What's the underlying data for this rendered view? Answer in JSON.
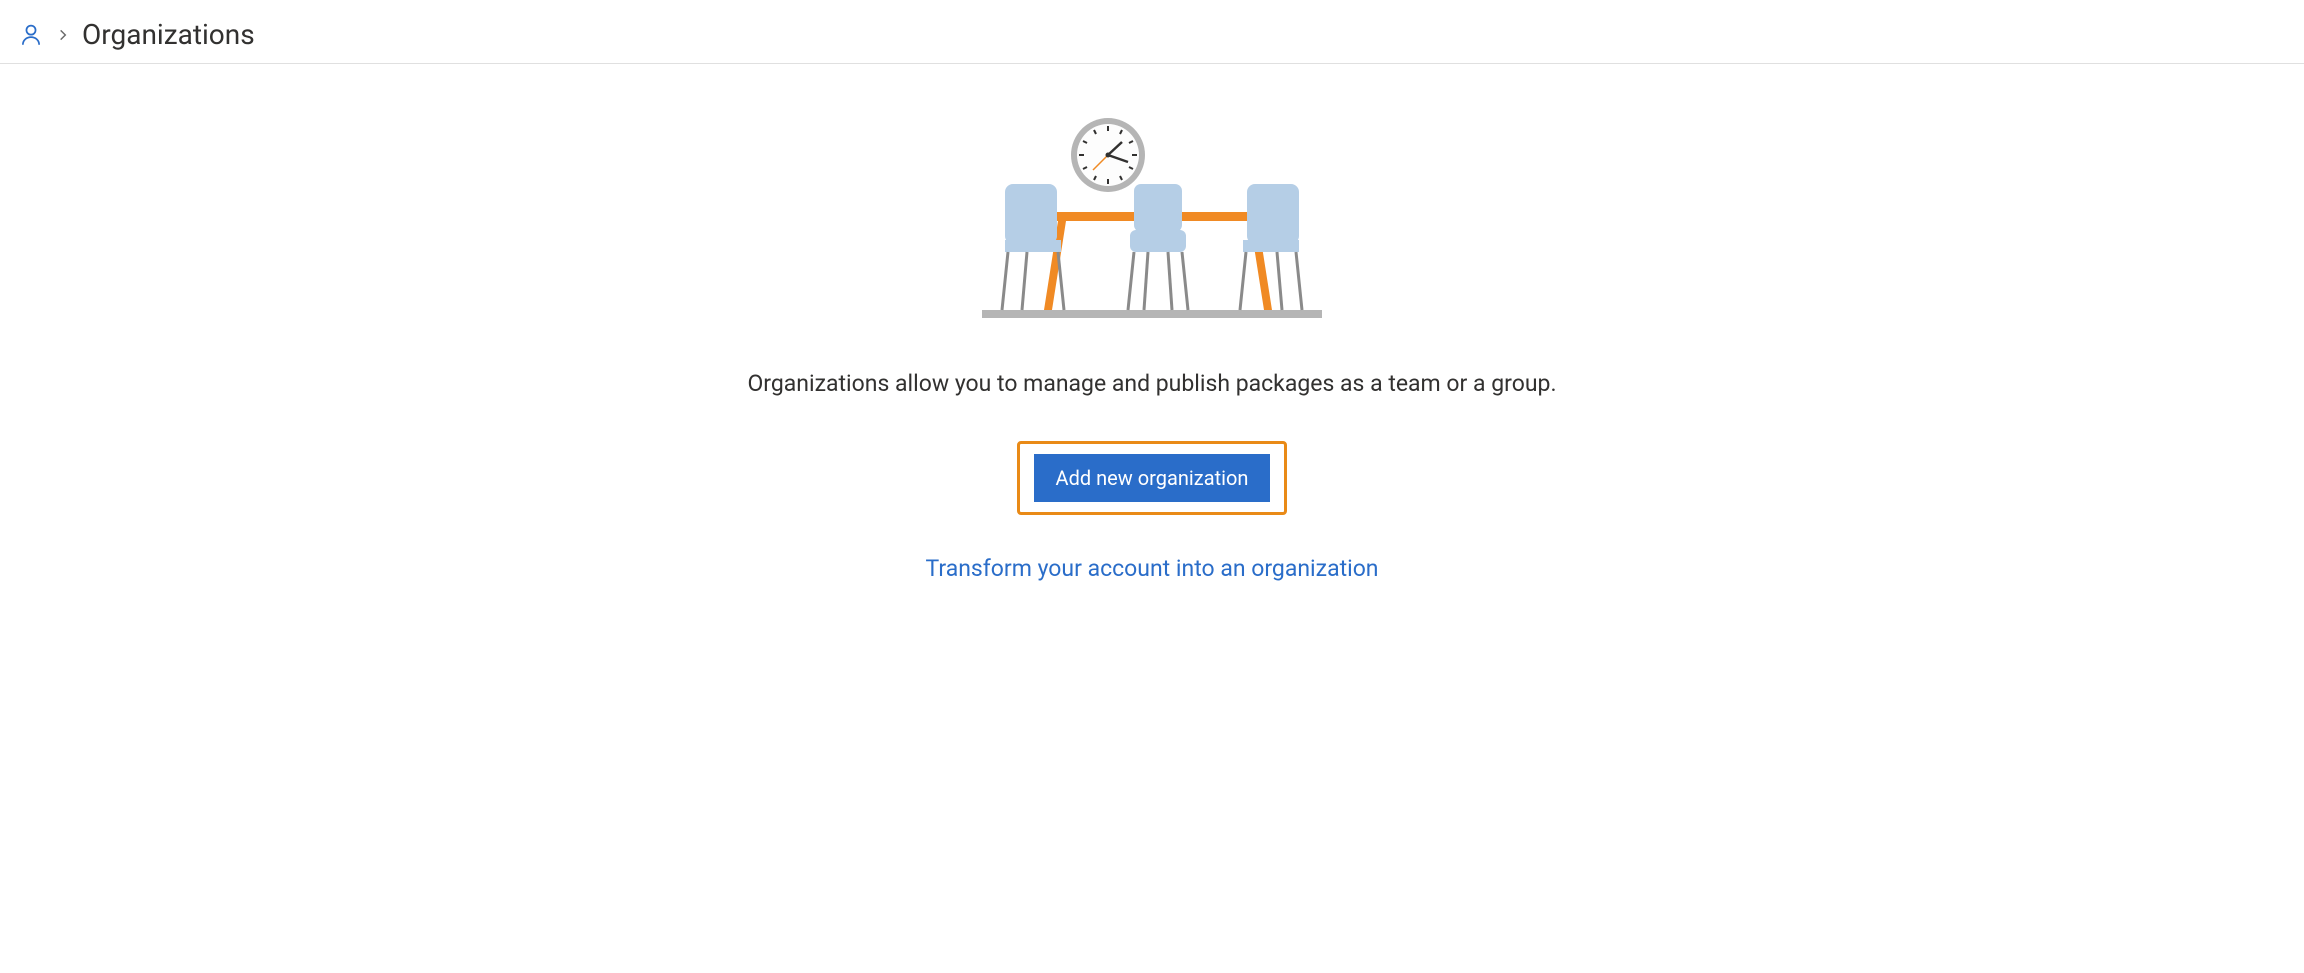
{
  "breadcrumb": {
    "page_title": "Organizations"
  },
  "main": {
    "description": "Organizations allow you to manage and publish packages as a team or a group.",
    "add_button_label": "Add new organization",
    "transform_link_label": "Transform your account into an organization"
  },
  "colors": {
    "accent": "#2a6dc9",
    "highlight_border": "#e98a17",
    "chair_fill": "#b5cee6",
    "table_orange": "#f08a24",
    "floor_gray": "#b5b5b5",
    "leg_gray": "#8a8a8a"
  }
}
